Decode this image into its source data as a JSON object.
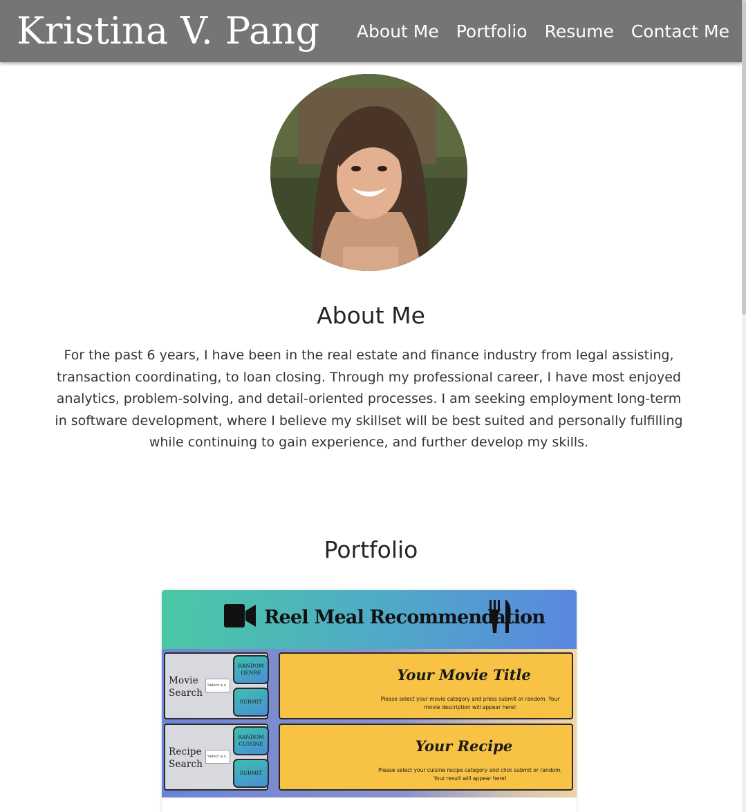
{
  "navbar": {
    "brand": "Kristina V. Pang",
    "links": [
      "About Me",
      "Portfolio",
      "Resume",
      "Contact Me"
    ]
  },
  "about": {
    "title": "About Me",
    "text": "For the past 6 years, I have been in the real estate and finance industry from legal assisting, transaction coordinating, to loan closing. Through my professional career, I have most enjoyed analytics, problem-solving, and detail-oriented processes. I am seeking employment long-term in software development, where I believe my skillset will be best suited and personally fulfilling while continuing to gain experience, and further develop my skills."
  },
  "portfolio": {
    "title": "Portfolio",
    "project": {
      "app_title": "Reel Meal Recommendation",
      "movie_panel": {
        "label": "Movie Search",
        "select_placeholder": "Select a c",
        "random_button": "Random Genre",
        "submit_button": "Submit"
      },
      "recipe_panel": {
        "label": "Recipe Search",
        "select_placeholder": "Select a c",
        "random_button": "Random Cuisine",
        "submit_button": "Submit"
      },
      "movie_result": {
        "title": "Your Movie Title",
        "description": "Please select your movie category and press submit or random. Your movie description will appear here!"
      },
      "recipe_result": {
        "title": "Your Recipe",
        "description": "Please select your cuisine recipe category and click submit or random. Your result will appear here!"
      }
    }
  },
  "colors": {
    "navbar": "#757575",
    "result_box": "#f8c245",
    "header_gradient_start": "#4ac9a4",
    "header_gradient_end": "#5a86e0"
  },
  "icons": [
    "video-camera-icon",
    "utensils-icon"
  ]
}
